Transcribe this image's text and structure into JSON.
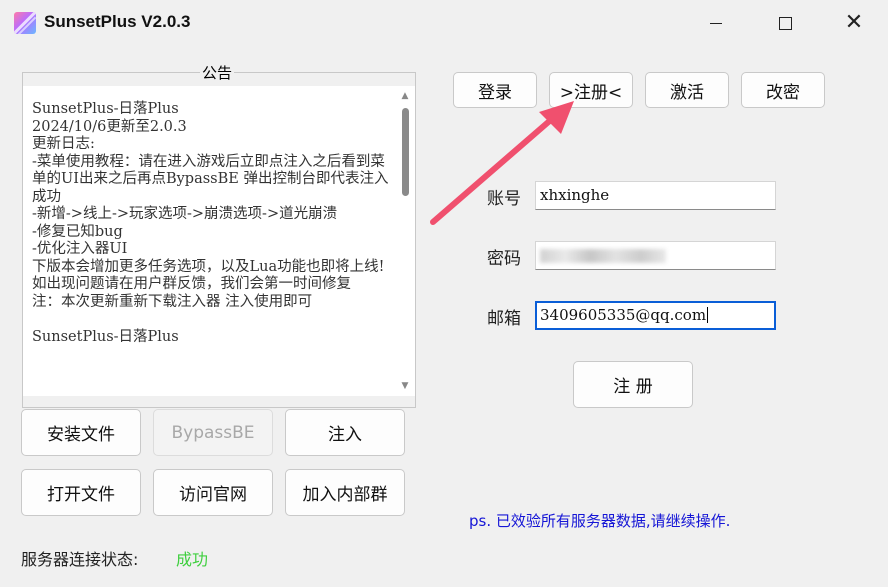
{
  "window": {
    "title": "SunsetPlus V2.0.3",
    "minimize_glyph": "",
    "close_glyph": "✕"
  },
  "notice": {
    "label": "公告",
    "text": "SunsetPlus-日落Plus\n2024/10/6更新至2.0.3\n更新日志:\n-菜单使用教程：请在进入游戏后立即点注入之后看到菜单的UI出来之后再点BypassBE 弹出控制台即代表注入成功\n-新增->线上->玩家选项->崩溃选项->道光崩溃\n-修复已知bug\n-优化注入器UI\n下版本会增加更多任务选项，以及Lua功能也即将上线!\n如出现问题请在用户群反馈，我们会第一时间修复\n注：本次更新重新下载注入器 注入使用即可\n\nSunsetPlus-日落Plus"
  },
  "left_buttons": {
    "install": "安装文件",
    "bypass": "BypassBE",
    "inject": "注入",
    "open_file": "打开文件",
    "visit_site": "访问官网",
    "join_group": "加入内部群"
  },
  "tabs": {
    "login": "登录",
    "register": ">注册<",
    "activate": "激活",
    "change_password": "改密"
  },
  "form": {
    "account_label": "账号",
    "account_value": "xhxinghe",
    "password_label": "密码",
    "email_label": "邮箱",
    "email_value": "3409605335@qq.com",
    "submit_label": "注 册"
  },
  "ps_message": "ps. 已效验所有服务器数据,请继续操作.",
  "status": {
    "label": "服务器连接状态:",
    "value": "成功",
    "value_color": "#3fcf3f"
  },
  "colors": {
    "accent": "#0a5ed7",
    "arrow": "#f0506e",
    "ps_text": "#1515d6"
  },
  "icons": {
    "app": "sunsetplus-logo-icon",
    "arrow": "annotation-arrow"
  }
}
